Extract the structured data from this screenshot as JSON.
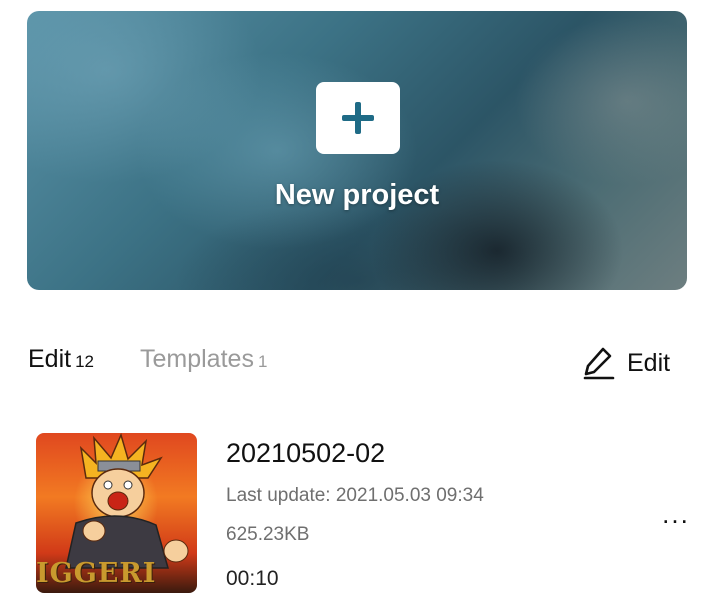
{
  "banner": {
    "new_project_label": "New project",
    "icon": "plus-icon",
    "accent_color": "#1f6b86"
  },
  "tabs": [
    {
      "label": "Edit",
      "count": "12",
      "active": true
    },
    {
      "label": "Templates",
      "count": "1",
      "active": false
    }
  ],
  "edit_action": {
    "label": "Edit",
    "icon": "pencil-icon"
  },
  "projects": [
    {
      "title": "20210502-02",
      "last_update": "Last update: 2021.05.03 09:34",
      "size": "625.23KB",
      "duration": "00:10",
      "thumbnail_text": "IGGERI",
      "menu_label": "..."
    }
  ]
}
